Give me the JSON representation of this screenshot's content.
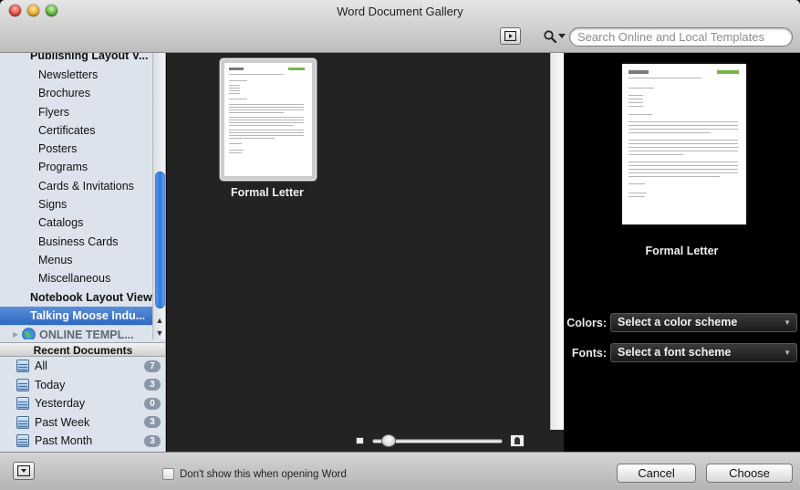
{
  "window": {
    "title": "Word Document Gallery"
  },
  "toolbar": {
    "search_placeholder": "Search Online and Local Templates",
    "preview_toggle_icon": "play-square-icon",
    "search_icon": "magnifier-icon"
  },
  "sidebar": {
    "categories": [
      {
        "label": "Publishing Layout V...",
        "kind": "header"
      },
      {
        "label": "Newsletters"
      },
      {
        "label": "Brochures"
      },
      {
        "label": "Flyers"
      },
      {
        "label": "Certificates"
      },
      {
        "label": "Posters"
      },
      {
        "label": "Programs"
      },
      {
        "label": "Cards & Invitations"
      },
      {
        "label": "Signs"
      },
      {
        "label": "Catalogs"
      },
      {
        "label": "Business Cards"
      },
      {
        "label": "Menus"
      },
      {
        "label": "Miscellaneous"
      },
      {
        "label": "Notebook Layout View",
        "kind": "header"
      },
      {
        "label": "Talking Moose Indu...",
        "kind": "selected"
      },
      {
        "label": "ONLINE TEMPL...",
        "kind": "online"
      }
    ],
    "recent_header": "Recent Documents",
    "recent": [
      {
        "label": "All",
        "count": "7"
      },
      {
        "label": "Today",
        "count": "3"
      },
      {
        "label": "Yesterday",
        "count": "0"
      },
      {
        "label": "Past Week",
        "count": "3"
      },
      {
        "label": "Past Month",
        "count": "3"
      }
    ]
  },
  "gallery": {
    "items": [
      {
        "label": "Formal Letter"
      }
    ]
  },
  "preview": {
    "label": "Formal Letter",
    "colors_label": "Colors:",
    "colors_value": "Select a color scheme",
    "fonts_label": "Fonts:",
    "fonts_value": "Select a font scheme"
  },
  "footer": {
    "checkbox_label": "Don't show this when opening Word",
    "checkbox_checked": false,
    "cancel_label": "Cancel",
    "choose_label": "Choose"
  },
  "colors": {
    "selection": "#2c69c3",
    "gallery_bg": "#232323",
    "sidebar_bg": "#dce3ec",
    "accent_green": "#78b548"
  }
}
